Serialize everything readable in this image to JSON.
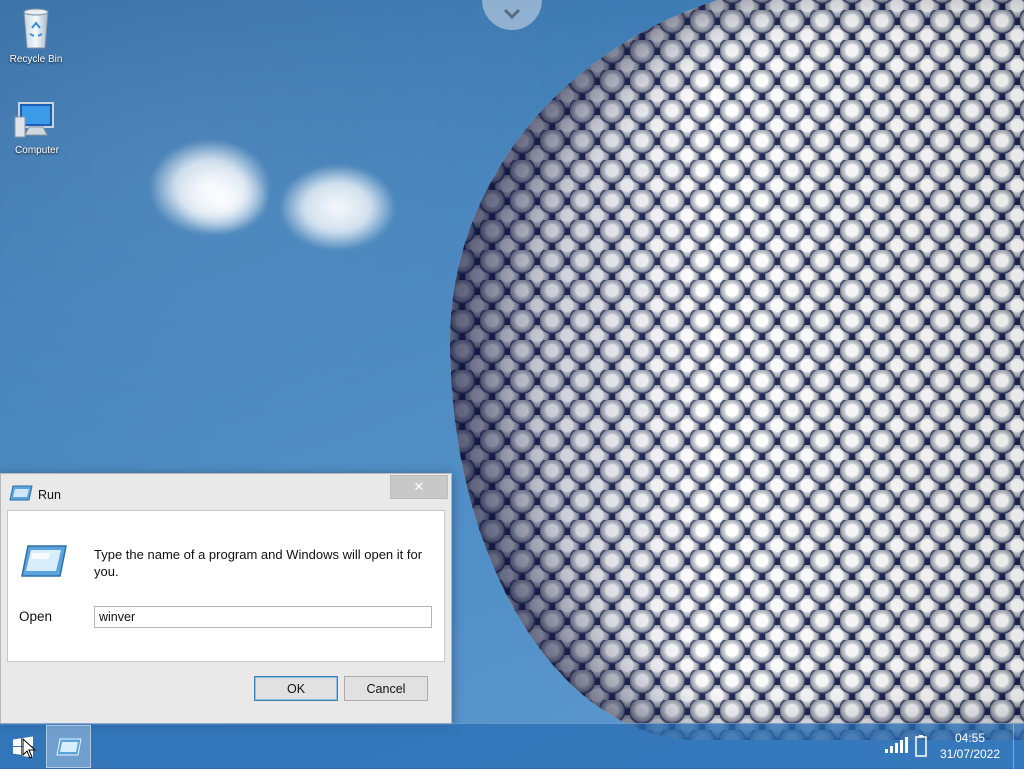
{
  "desktop": {
    "icons": [
      {
        "label": "Recycle Bin",
        "icon": "recycle-bin-icon"
      },
      {
        "label": "Computer",
        "icon": "computer-icon"
      }
    ]
  },
  "run_dialog": {
    "title": "Run",
    "description": "Type the name of a program and Windows will open it for you.",
    "open_label": "Open",
    "open_value": "winver",
    "ok_label": "OK",
    "cancel_label": "Cancel",
    "close_symbol": "✕"
  },
  "taskbar": {
    "clock_time": "04:55",
    "clock_date": "31/07/2022",
    "accent": "#2f74c0"
  }
}
